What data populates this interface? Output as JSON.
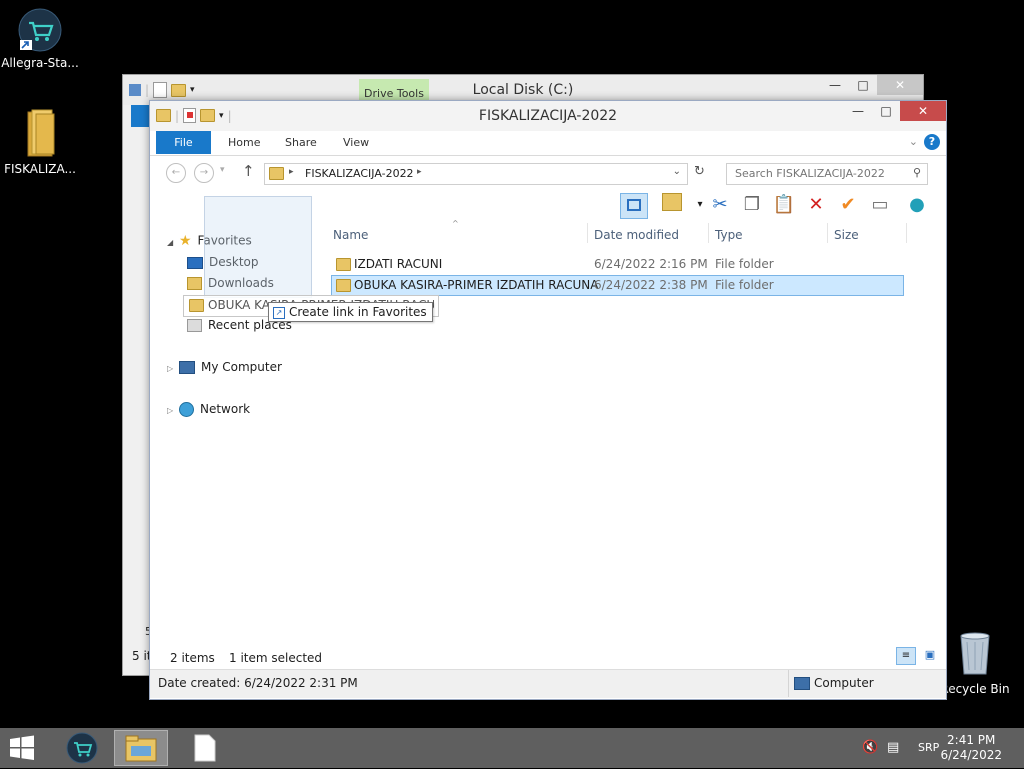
{
  "desktop": {
    "icons": [
      {
        "label": "Allegra-Sta..."
      },
      {
        "label": "FISKALIZA..."
      },
      {
        "label": "Recycle Bin"
      }
    ]
  },
  "back_window": {
    "title": "Local Disk (C:)",
    "context_tab": "Drive Tools",
    "status_fragment": "5 it",
    "row_fragment": "5"
  },
  "window": {
    "title": "FISKALIZACIJA-2022",
    "ribbon_tabs": [
      "File",
      "Home",
      "Share",
      "View"
    ],
    "address": "FISKALIZACIJA-2022",
    "search_placeholder": "Search FISKALIZACIJA-2022",
    "nav": {
      "favorites": "Favorites",
      "desktop": "Desktop",
      "downloads": "Downloads",
      "recent": "Recent places",
      "my_computer": "My Computer",
      "network": "Network"
    },
    "columns": [
      "Name",
      "Date modified",
      "Type",
      "Size"
    ],
    "rows": [
      {
        "name": "IZDATI RACUNI",
        "date": "6/24/2022 2:16 PM",
        "type": "File folder",
        "selected": false
      },
      {
        "name": "OBUKA KASIRA-PRIMER IZDATIH RACUNA",
        "date": "6/24/2022 2:38 PM",
        "type": "File folder",
        "selected": true
      }
    ],
    "status": {
      "items": "2 items",
      "selected": "1 item selected",
      "date_created": "Date created: 6/24/2022 2:31 PM",
      "location": "Computer"
    }
  },
  "drag": {
    "item_label": "OBUKA KASIRA-PRIMER IZDATIH RACUNA",
    "tooltip": "Create link in Favorites"
  },
  "taskbar": {
    "language": "SRP",
    "time": "2:41 PM",
    "date": "6/24/2022"
  },
  "colors": {
    "accent": "#1979ca",
    "selection": "#cce8ff",
    "close_red": "#c74b4b",
    "taskbar": "#5f5f5f"
  }
}
